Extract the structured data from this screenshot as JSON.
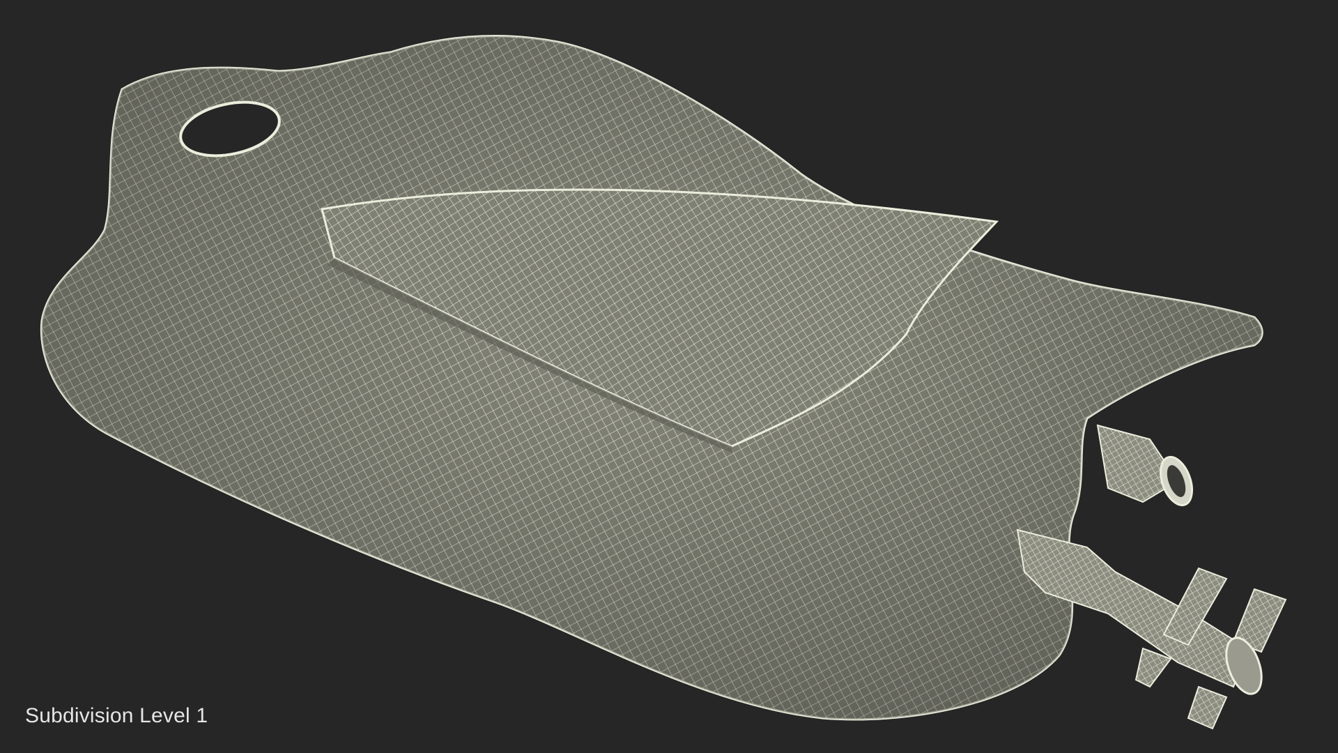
{
  "viewport": {
    "background_color": "#262626",
    "caption": "Subdivision Level 1"
  },
  "model": {
    "surface_color": "#86877a",
    "wire_color": "#eceedd",
    "icon": "iv-bag-wireframe"
  }
}
